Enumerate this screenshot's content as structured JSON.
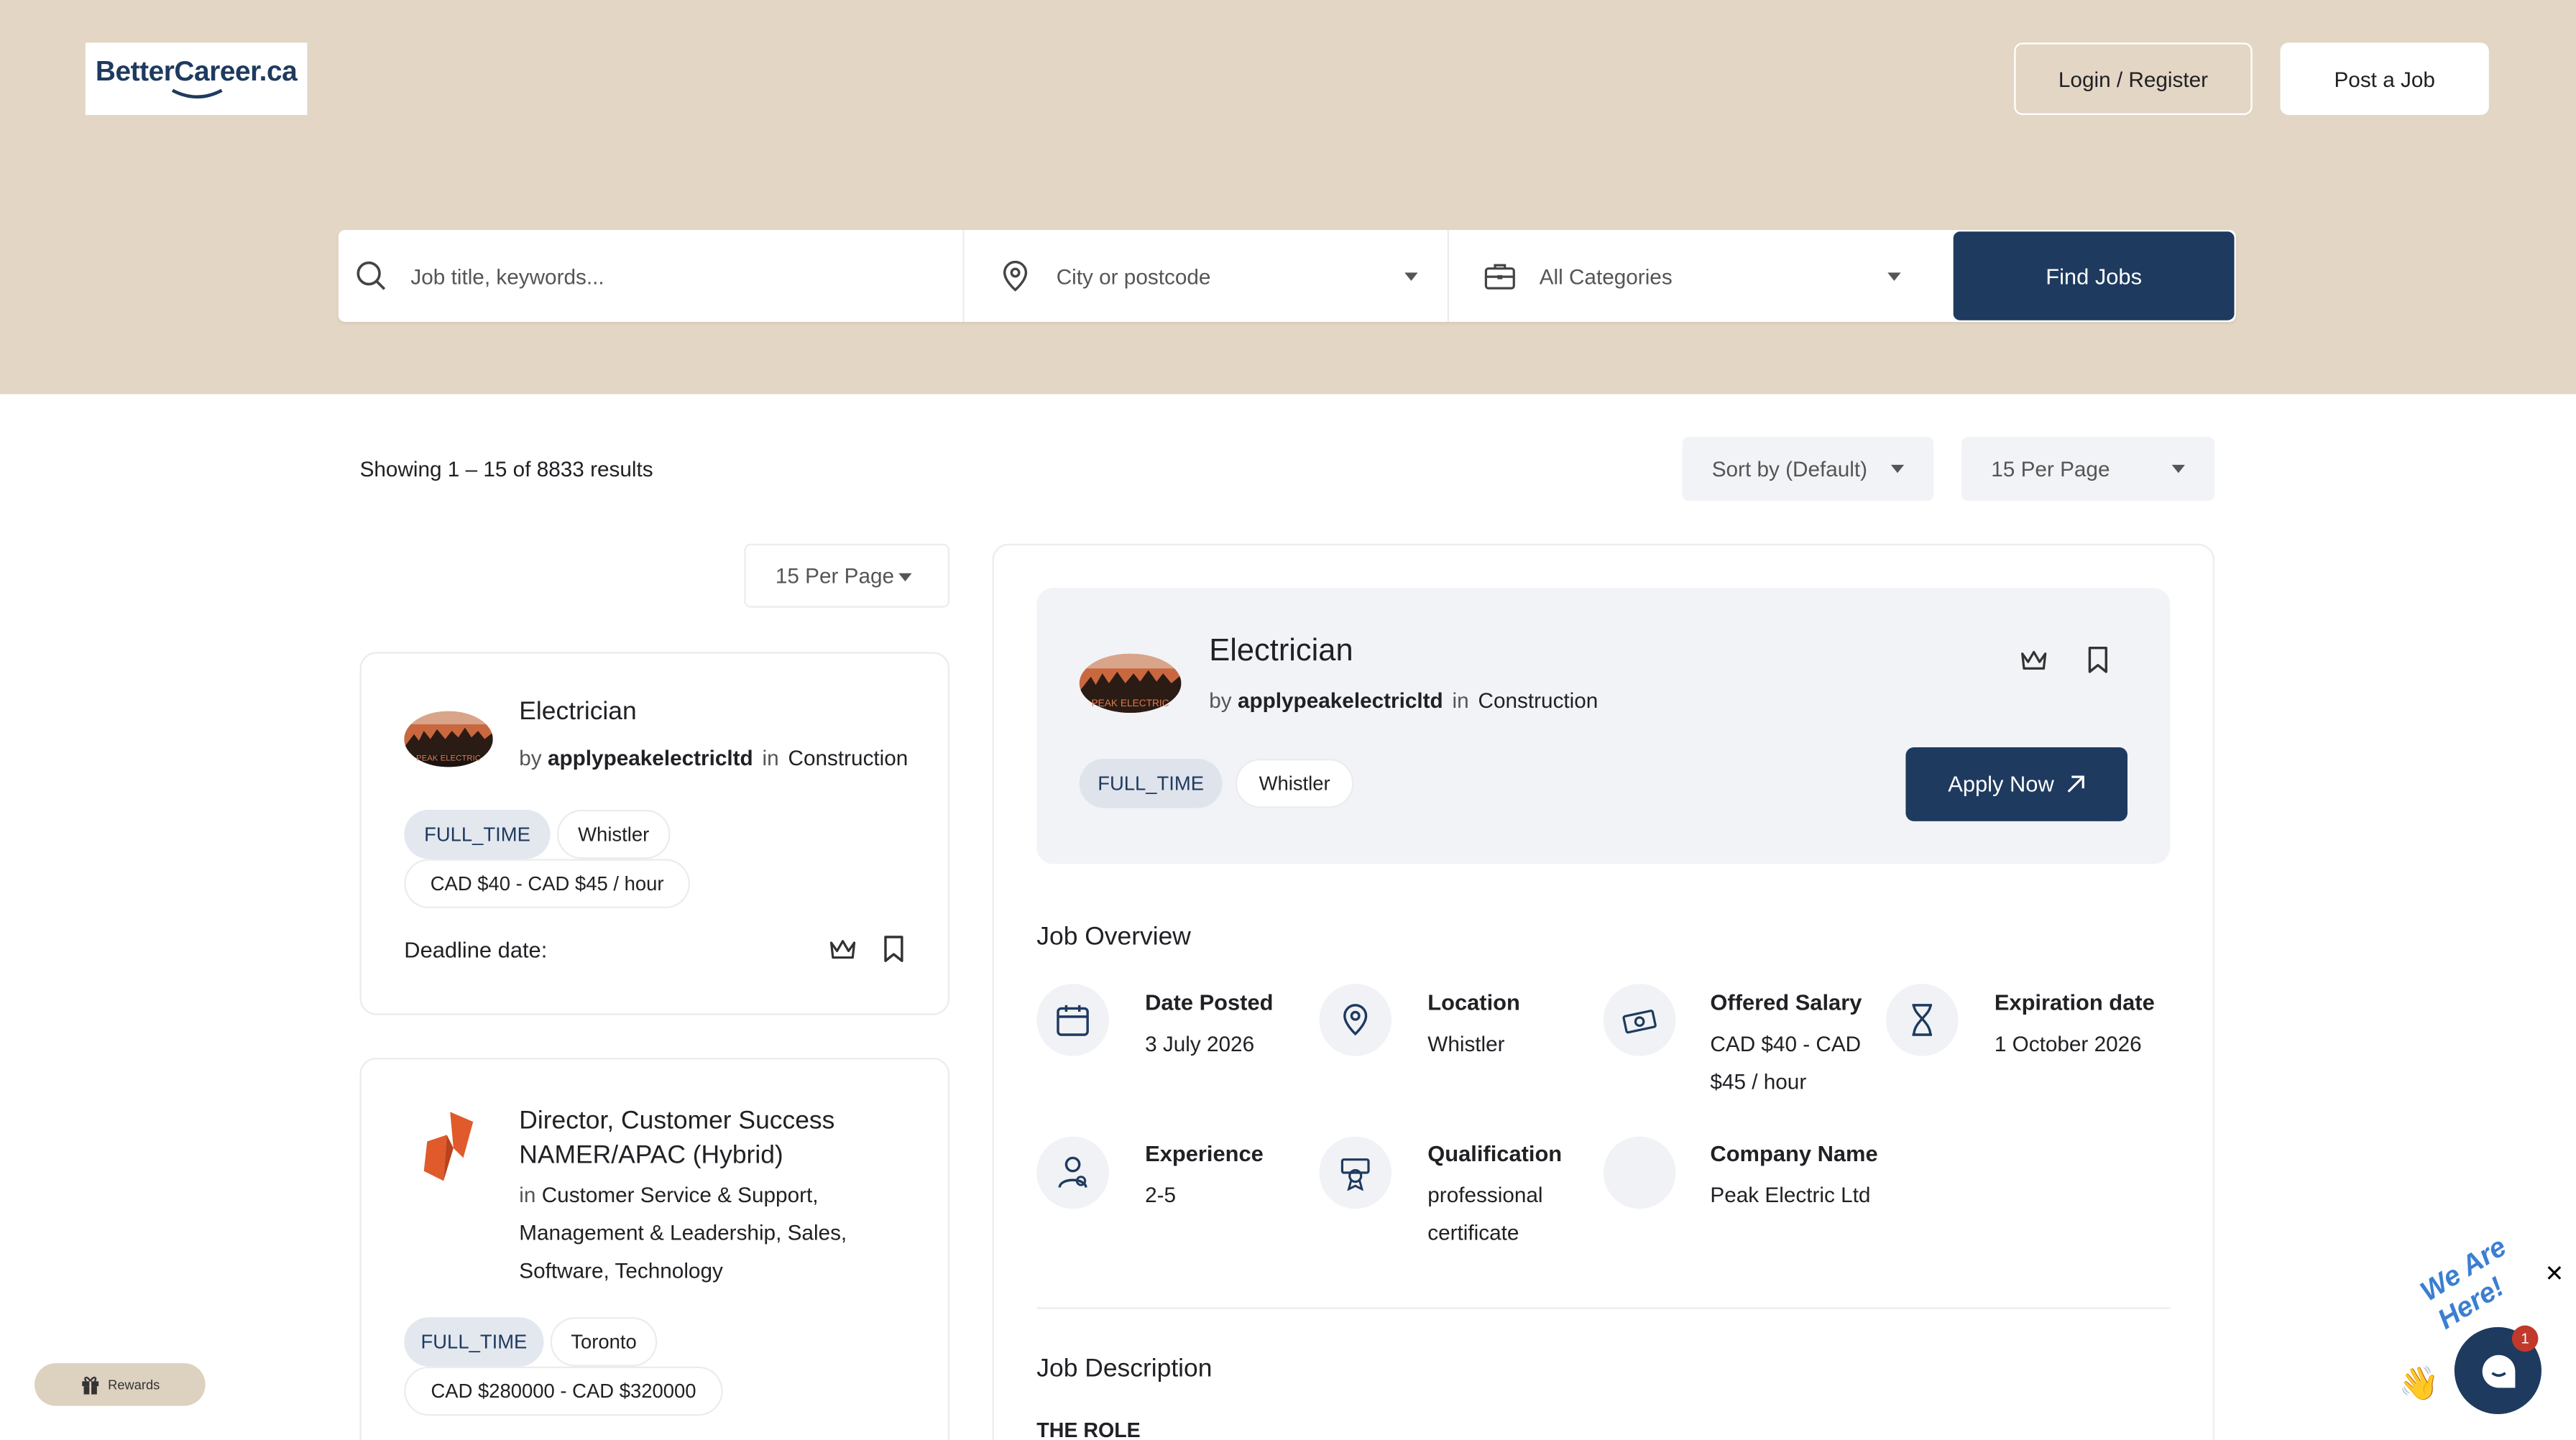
{
  "brand": {
    "logo_text": "BetterCareer.ca"
  },
  "header": {
    "login_label": "Login / Register",
    "post_job_label": "Post a Job"
  },
  "search": {
    "keywords_placeholder": "Job title, keywords...",
    "location_placeholder": "City or postcode",
    "category_value": "All Categories",
    "find_label": "Find Jobs"
  },
  "listing": {
    "results_text": "Showing 1 – 15 of 8833 results",
    "sort_value": "Sort by (Default)",
    "per_page_value": "15 Per Page",
    "per_page_side_value": "15 Per Page"
  },
  "jobs": [
    {
      "title": "Electrician",
      "by_prefix": "by",
      "company": "applypeakelectricltd",
      "in_prefix": "in",
      "category": "Construction",
      "type": "FULL_TIME",
      "location": "Whistler",
      "salary": "CAD $40 - CAD $45 / hour",
      "deadline_label": "Deadline date:",
      "logo_text": "PEAK ELECTRIC"
    },
    {
      "title_line1": "Director, Customer Success",
      "title_line2": "NAMER/APAC (Hybrid)",
      "in_prefix": "in",
      "categories_line1": "Customer Service & Support,",
      "categories_line2": "Management & Leadership, Sales,",
      "categories_line3": "Software, Technology",
      "type": "FULL_TIME",
      "location": "Toronto",
      "salary": "CAD $280000 - CAD $320000"
    }
  ],
  "detail": {
    "title": "Electrician",
    "by_prefix": "by",
    "company": "applypeakelectricltd",
    "in_prefix": "in",
    "category": "Construction",
    "type": "FULL_TIME",
    "location": "Whistler",
    "apply_label": "Apply Now",
    "logo_text": "PEAK ELECTRIC",
    "overview_heading": "Job Overview",
    "overview": {
      "date_posted_label": "Date Posted",
      "date_posted_value": "3 July 2026",
      "location_label": "Location",
      "location_value": "Whistler",
      "salary_label": "Offered Salary",
      "salary_line1": "CAD $40 - CAD",
      "salary_line2": "$45 / hour",
      "expiration_label": "Expiration date",
      "expiration_value": "1 October 2026",
      "experience_label": "Experience",
      "experience_value": "2-5",
      "qualification_label": "Qualification",
      "qualification_line1": "professional",
      "qualification_line2": "certificate",
      "company_label": "Company Name",
      "company_value": "Peak Electric Ltd"
    },
    "description_heading": "Job Description",
    "role_heading": "THE ROLE"
  },
  "widgets": {
    "rewards_label": "Rewards",
    "chat_badge_count": "1",
    "chat_tagline": "We Are Here!",
    "close_symbol": "✕"
  },
  "colors": {
    "hero_bg": "#e3d6c4",
    "primary": "#1e3a5f",
    "pill_bg": "#e3e8ef"
  }
}
